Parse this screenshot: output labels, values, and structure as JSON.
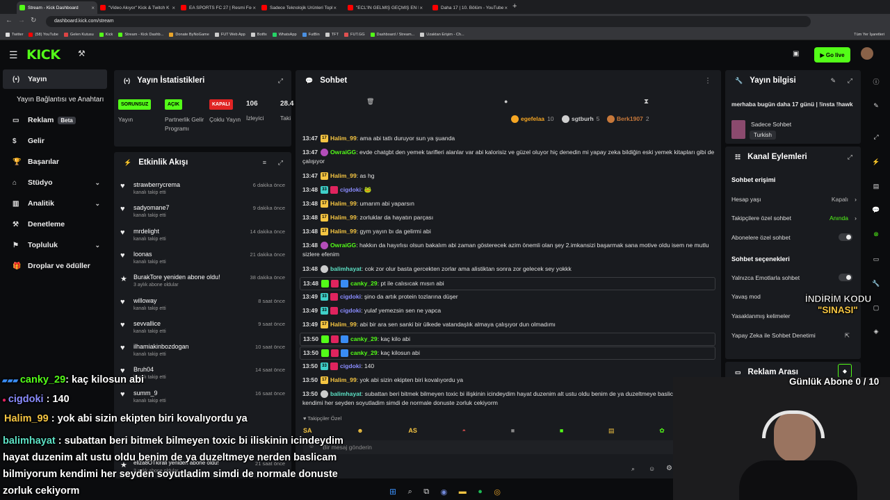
{
  "browser": {
    "tabs": [
      {
        "title": "Stream - Kick Dashboard",
        "active": true,
        "color": "#53fc18"
      },
      {
        "title": "\"Video Akıyor\" Kick & Twitch K",
        "color": "#ff0000"
      },
      {
        "title": "EA SPORTS FC 27 | Resmi Footb",
        "color": "#ff0000"
      },
      {
        "title": "Sadece Teknolojik Ürünleri Topl",
        "color": "#ff0000"
      },
      {
        "title": "\"ECL'İN GELMİŞ GEÇMİŞ EN İYİ",
        "color": "#ff0000"
      },
      {
        "title": "Daha 17 | 10. Bölüm - YouTube",
        "color": "#ff0000"
      }
    ],
    "url": "dashboard.kick.com/stream",
    "bookmarks": [
      "Twitter",
      "(58) YouTube",
      "Gelen Kutusu",
      "Kick",
      "Stream - Kick Dashb...",
      "Donate ByNoGame",
      "FUT Web App",
      "Botfix",
      "WhatsApp",
      "FutBin",
      "TFT",
      "FUT.GG",
      "Dashboard / Stream...",
      "Uzaktan Erişim - Ch..."
    ],
    "bookmarks_all": "Tüm Yer İşaretleri"
  },
  "kick": {
    "logo": "KICK",
    "go_live": "Go live"
  },
  "sidebar": {
    "items": [
      {
        "label": "Yayın",
        "icon": "broadcast-icon"
      },
      {
        "label": "Yayın Bağlantısı ve Anahtarı",
        "icon": ""
      },
      {
        "label": "Reklam",
        "icon": "ad-icon",
        "badge": "Beta"
      },
      {
        "label": "Gelir",
        "icon": "money-icon"
      },
      {
        "label": "Başarılar",
        "icon": "trophy-icon"
      },
      {
        "label": "Stüdyo",
        "icon": "studio-icon"
      },
      {
        "label": "Analitik",
        "icon": "analytics-icon"
      },
      {
        "label": "Denetleme",
        "icon": "moderation-icon"
      },
      {
        "label": "Topluluk",
        "icon": "community-icon"
      },
      {
        "label": "Droplar ve ödüller",
        "icon": "gift-icon"
      }
    ]
  },
  "stats": {
    "title": "Yayın İstatistikleri",
    "pills": [
      {
        "badge": "SORUNSUZ",
        "label": "Yayın",
        "color": "#53fc18"
      },
      {
        "badge": "AÇIK",
        "label": "Partnerlik Gelir Programı",
        "color": "#53fc18"
      },
      {
        "badge": "KAPALI",
        "label": "Çoklu Yayın",
        "color": "#e02424"
      }
    ],
    "viewers": "106",
    "viewers_label": "İzleyici",
    "followers": "28.4",
    "followers_label": "Taki"
  },
  "activity": {
    "title": "Etkinlik Akışı",
    "events": [
      {
        "name": "strawberrycrema",
        "sub": "kanalı takip etti",
        "time": "6 dakika önce"
      },
      {
        "name": "sadyomane7",
        "sub": "kanalı takip etti",
        "time": "9 dakika önce"
      },
      {
        "name": "mrdelight",
        "sub": "kanalı takip etti",
        "time": "14 dakika önce"
      },
      {
        "name": "loonas",
        "sub": "kanalı takip etti",
        "time": "21 dakika önce"
      },
      {
        "name": "BurakTore yeniden abone oldu!",
        "sub": "3 aylık abone oldular",
        "time": "38 dakika önce"
      },
      {
        "name": "willoway",
        "sub": "kanalı takip etti",
        "time": "8 saat önce"
      },
      {
        "name": "sevvallice",
        "sub": "kanalı takip etti",
        "time": "9 saat önce"
      },
      {
        "name": "ilhamiakinbozdogan",
        "sub": "kanalı takip etti",
        "time": "10 saat önce"
      },
      {
        "name": "Bruh04",
        "sub": "kanalı takip etti",
        "time": "14 saat önce"
      },
      {
        "name": "summ_9",
        "sub": "kanalı takip etti",
        "time": "16 saat önce"
      }
    ],
    "extra": [
      {
        "name": "eliza8OTkirali yeniden abone oldu!",
        "sub": "3 aylık abone oldular",
        "time": "21 saat önce"
      }
    ]
  },
  "chat": {
    "title": "Sohbet",
    "top_users": [
      {
        "name": "egefelaa",
        "count": "10",
        "color": "#f5a623"
      },
      {
        "name": "sgtburh",
        "count": "5",
        "color": "#cfcfcf"
      },
      {
        "name": "Berk1907",
        "count": "2",
        "color": "#c7783a"
      }
    ],
    "messages": [
      {
        "time": "13:47",
        "badge": "17",
        "user": "Halim_99",
        "color": "#f5c542",
        "text": "ama abi tatlı duruyor sun ya şuanda",
        "hl": false
      },
      {
        "time": "13:47",
        "badge": "",
        "user": "OwraiGG",
        "color": "#53fc18",
        "text": "evde chatgbt den yemek tarifleri alanlar var abi kalorisiz ve güzel oluyor hiç denedin mi yapay zeka bildiğin eski yemek kitapları gibi de çalışıyor",
        "hl": false
      },
      {
        "time": "13:47",
        "badge": "17",
        "user": "Halim_99",
        "color": "#f5c542",
        "text": "as hg",
        "hl": false
      },
      {
        "time": "13:48",
        "badge": "33",
        "user": "cigdoki",
        "color": "#8a8cff",
        "text": "🐸",
        "hl": false
      },
      {
        "time": "13:48",
        "badge": "17",
        "user": "Halim_99",
        "color": "#f5c542",
        "text": "umarım abi yaparsın",
        "hl": false
      },
      {
        "time": "13:48",
        "badge": "17",
        "user": "Halim_99",
        "color": "#f5c542",
        "text": "zorluklar da hayatın parçası",
        "hl": false
      },
      {
        "time": "13:48",
        "badge": "17",
        "user": "Halim_99",
        "color": "#f5c542",
        "text": "gym yayın bı da gelirmi abi",
        "hl": false
      },
      {
        "time": "13:48",
        "badge": "",
        "user": "OwraiGG",
        "color": "#53fc18",
        "text": "hakkın da hayırlısı olsun bakalım abi zaman gösterecek azim önemli olan şey 2.imkansizi başarmak sana motive oldu isem ne mutlu sizlere efenim",
        "hl": false
      },
      {
        "time": "13:48",
        "badge": "",
        "user": "balimhayat",
        "color": "#5ce0c4",
        "text": "cok zor olur basta gercekten zorlar ama alistiktan sonra zor gelecek sey yokkk",
        "hl": false
      },
      {
        "time": "13:48",
        "badge": "",
        "user": "canky_29",
        "color": "#53fc18",
        "text": "pt ile calısıcak mısın abi",
        "hl": true
      },
      {
        "time": "13:49",
        "badge": "33",
        "user": "cigdoki",
        "color": "#8a8cff",
        "text": "şino da artık protein tozlarına düşer",
        "hl": false
      },
      {
        "time": "13:49",
        "badge": "33",
        "user": "cigdoki",
        "color": "#8a8cff",
        "text": "yulaf yemezsin sen ne yapca",
        "hl": false
      },
      {
        "time": "13:49",
        "badge": "17",
        "user": "Halim_99",
        "color": "#f5c542",
        "text": "abi bir ara sen sanki bir ülkede vatandaşlık almaya çalışıyor dun olmadımı",
        "hl": false
      },
      {
        "time": "13:50",
        "badge": "",
        "user": "canky_29",
        "color": "#53fc18",
        "text": "kaç kilo abi",
        "hl": true
      },
      {
        "time": "13:50",
        "badge": "",
        "user": "canky_29",
        "color": "#53fc18",
        "text": "kaç kilosun abi",
        "hl": true
      },
      {
        "time": "13:50",
        "badge": "33",
        "user": "cigdoki",
        "color": "#8a8cff",
        "text": "140",
        "hl": false
      },
      {
        "time": "13:50",
        "badge": "17",
        "user": "Halim_99",
        "color": "#f5c542",
        "text": "yok abi sizin ekipten biri kovalıyordu ya",
        "hl": false
      },
      {
        "time": "13:50",
        "badge": "",
        "user": "balimhayat",
        "color": "#5ce0c4",
        "text": "subattan beri bitmek bilmeyen toxic bi ilişkinin icindeydim hayat duzenim alt ustu oldu benim de ya duzeltmeye baslicam bilmiyorum kendimi her seyden soyutladim simdi de normale donuste zorluk cekiyorm",
        "hl": false
      }
    ],
    "followers_only": "Takipçiler Özel",
    "placeholder": "Bir mesaj gönderin"
  },
  "stream_info": {
    "title": "Yayın bilgisi",
    "stream_title": "merhaba bugün daha 17 günü | !insta !hawk",
    "category": "Sadece Sohbet",
    "language": "Turkish"
  },
  "channel_actions": {
    "title": "Kanal Eylemleri",
    "chat_access": "Sohbet erişimi",
    "rows": [
      {
        "label": "Hesap yaşı",
        "value": "Kapalı"
      },
      {
        "label": "Takipçilere özel sohbet",
        "value": "Anında"
      },
      {
        "label": "Abonelere özel sohbet",
        "value": ""
      }
    ],
    "chat_options": "Sohbet seçenekleri",
    "rows2": [
      {
        "label": "Yalnızca Emotlarla sohbet"
      },
      {
        "label": "Yavaş mod"
      },
      {
        "label": "Yasaklanmış kelimeler"
      },
      {
        "label": "Yapay Zeka ile Sohbet Denetimi"
      }
    ],
    "ad_break": "Reklam Arası"
  },
  "overlay": {
    "promo_line1": "İNDİRİM KODU",
    "promo_line2": "\"SINASI\"",
    "daily_subs": "Günlük Abone 0 / 10",
    "chat": [
      {
        "user": "canky_29",
        "text": ": kaç kilosun abi",
        "color": "#53fc18"
      },
      {
        "user": "cigdoki",
        "text": " : 140",
        "color": "#8a8cff"
      },
      {
        "user": "Halim_99",
        "text": " : yok abi sizin ekipten biri kovalıyordu ya",
        "color": "#f5c542"
      },
      {
        "user": "balimhayat",
        "text": " : subattan beri bitmek bilmeyen toxic bi iliskinin icindeydim hayat duzenim alt ustu oldu benim de ya duzeltmeye nerden baslicam bilmiyorum kendimi her seyden soyutladim simdi de normale donuste zorluk cekiyorm",
        "color": "#5ce0c4"
      }
    ]
  }
}
